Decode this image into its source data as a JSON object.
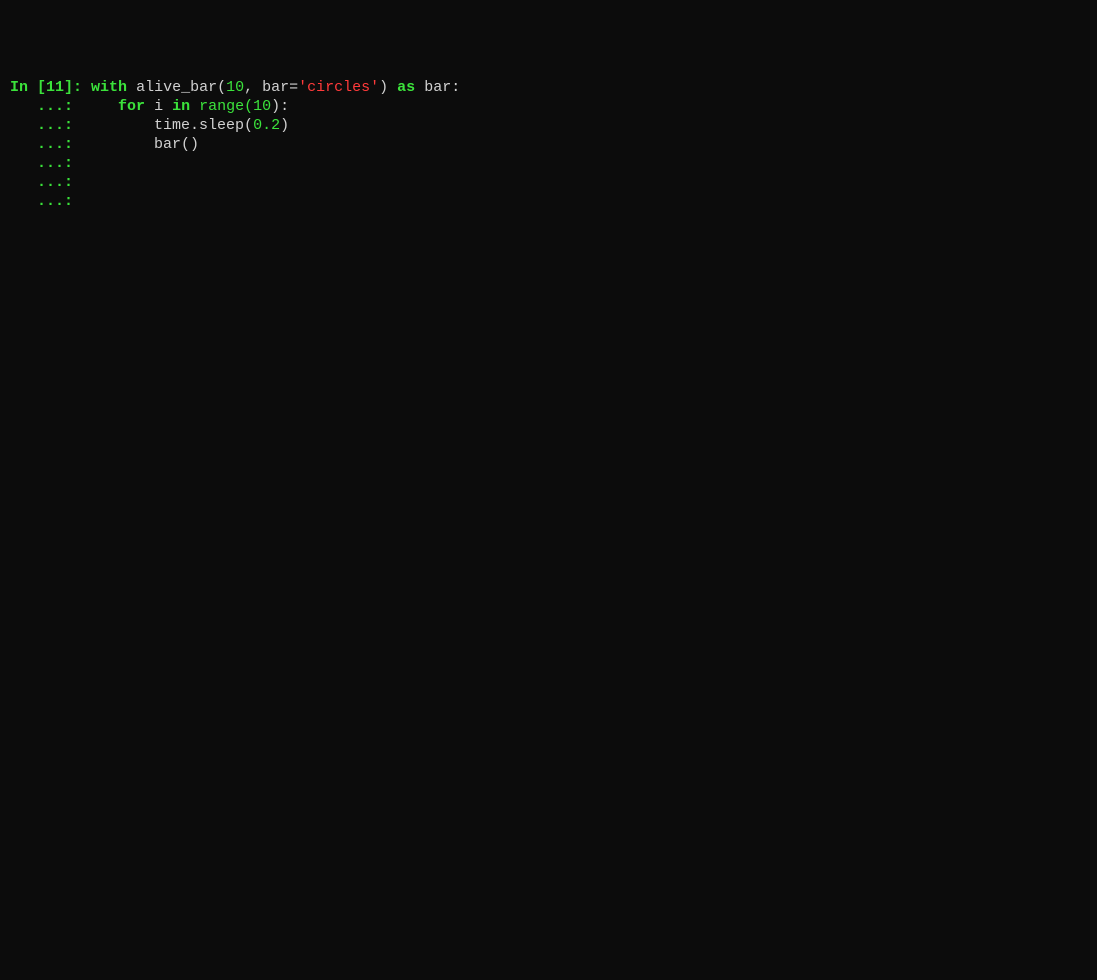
{
  "terminal": {
    "prompt_in": "In [",
    "prompt_num": "11",
    "prompt_close": "]: ",
    "continuation": "   ...: ",
    "line1": {
      "kw_with": "with",
      "sp1": " ",
      "fn": "alive_bar(",
      "arg1": "10",
      "comma": ", bar=",
      "str": "'circles'",
      "close_paren": ")",
      "sp2": " ",
      "kw_as": "as",
      "sp3": " ",
      "var": "bar:"
    },
    "line2": {
      "indent": "    ",
      "kw_for": "for",
      "sp1": " ",
      "var_i": "i",
      "sp2": " ",
      "kw_in": "in",
      "sp3": " ",
      "fn_range": "range(",
      "arg": "10",
      "close": "):"
    },
    "line3": {
      "indent": "        ",
      "call": "time.sleep(",
      "arg": "0.2",
      "close": ")"
    },
    "line4": {
      "indent": "        ",
      "call": "bar()"
    }
  }
}
